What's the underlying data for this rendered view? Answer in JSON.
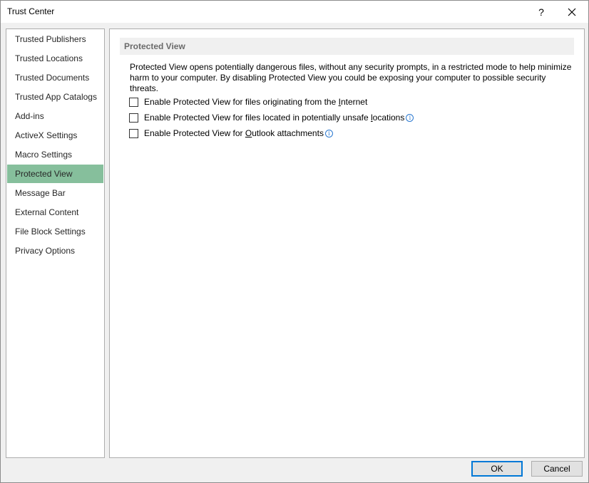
{
  "window": {
    "title": "Trust Center",
    "help_label": "?"
  },
  "sidebar": {
    "items": [
      {
        "label": "Trusted Publishers"
      },
      {
        "label": "Trusted Locations"
      },
      {
        "label": "Trusted Documents"
      },
      {
        "label": "Trusted App Catalogs"
      },
      {
        "label": "Add-ins"
      },
      {
        "label": "ActiveX Settings"
      },
      {
        "label": "Macro Settings"
      },
      {
        "label": "Protected View",
        "selected": true
      },
      {
        "label": "Message Bar"
      },
      {
        "label": "External Content"
      },
      {
        "label": "File Block Settings"
      },
      {
        "label": "Privacy Options"
      }
    ]
  },
  "main": {
    "section_title": "Protected View",
    "description": "Protected View opens potentially dangerous files, without any security prompts, in a restricted mode to help minimize harm to your computer. By disabling Protected View you could be exposing your computer to possible security threats.",
    "options": [
      {
        "before": "Enable Protected View for files originating from the ",
        "key": "I",
        "after": "nternet",
        "checked": false,
        "info": false
      },
      {
        "before": "Enable Protected View for files located in potentially unsafe ",
        "key": "l",
        "after": "ocations",
        "checked": false,
        "info": true
      },
      {
        "before": "Enable Protected View for ",
        "key": "O",
        "after": "utlook attachments",
        "checked": false,
        "info": true
      }
    ]
  },
  "footer": {
    "ok_label": "OK",
    "cancel_label": "Cancel"
  },
  "colors": {
    "selected_bg": "#86bf9c",
    "accent": "#0078d7",
    "info_icon": "#2b79d0"
  }
}
